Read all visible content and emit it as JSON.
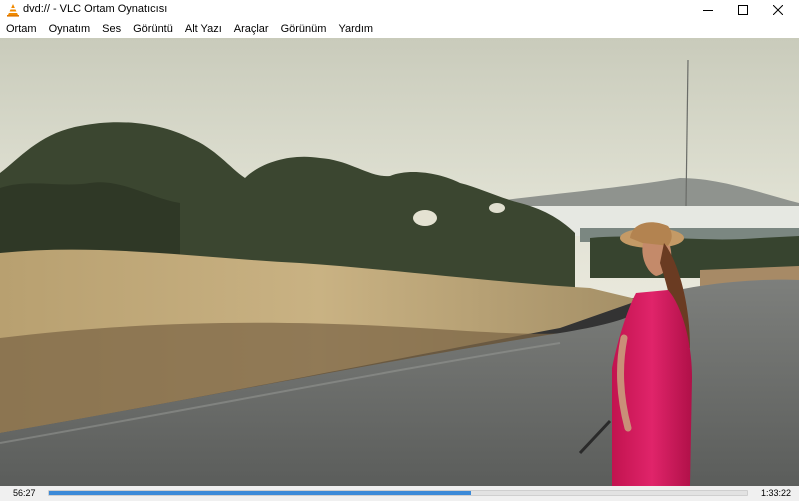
{
  "window": {
    "title": "dvd:// - VLC Ortam Oynatıcısı",
    "app_icon": "vlc-cone-icon",
    "controls": [
      "minimize-icon",
      "maximize-icon",
      "close-icon"
    ]
  },
  "menu": {
    "items": [
      {
        "label": "Ortam"
      },
      {
        "label": "Oynatım"
      },
      {
        "label": "Ses"
      },
      {
        "label": "Görüntü"
      },
      {
        "label": "Alt Yazı"
      },
      {
        "label": "Araçlar"
      },
      {
        "label": "Görünüm"
      },
      {
        "label": "Yardım"
      }
    ]
  },
  "playback": {
    "elapsed": "56:27",
    "total": "1:33:22",
    "progress": 0.605,
    "progress_color": "#3c8ad8"
  }
}
